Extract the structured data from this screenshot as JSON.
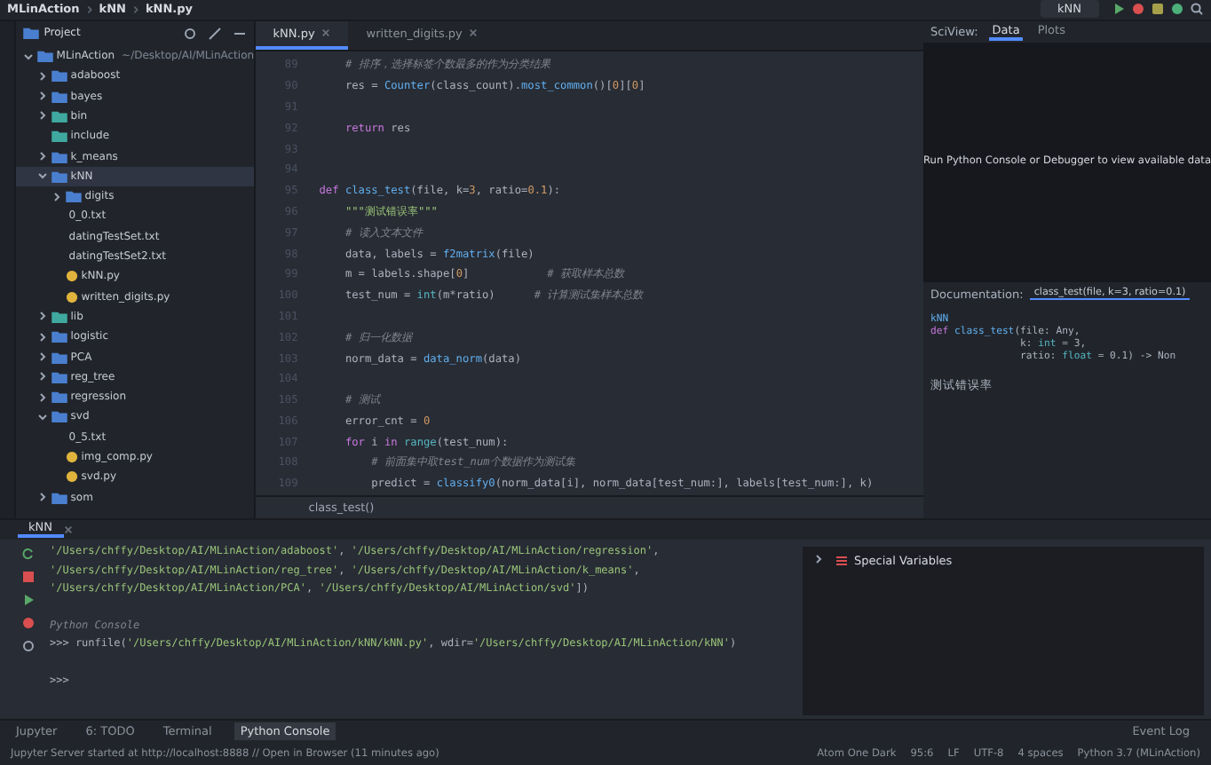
{
  "breadcrumb": [
    "MLinAction",
    "kNN",
    "kNN.py"
  ],
  "run_config": {
    "label": "kNN"
  },
  "project": {
    "title": "Project",
    "tree": [
      {
        "label": "MLinAction",
        "path": "~/Desktop/AI/MLinAction",
        "kind": "folder",
        "expanded": true,
        "selected": false,
        "children": [
          {
            "label": "adaboost",
            "kind": "folder",
            "expanded": false,
            "selected": false
          },
          {
            "label": "bayes",
            "kind": "folder",
            "expanded": false,
            "selected": false
          },
          {
            "label": "bin",
            "kind": "special_folder",
            "expanded": false,
            "selected": false
          },
          {
            "label": "include",
            "kind": "special_folder",
            "selected": false
          },
          {
            "label": "k_means",
            "kind": "folder",
            "expanded": false,
            "selected": false
          },
          {
            "label": "kNN",
            "kind": "folder",
            "expanded": true,
            "selected": true,
            "children": [
              {
                "label": "digits",
                "kind": "folder",
                "expanded": false,
                "selected": false
              },
              {
                "label": "0_0.txt",
                "kind": "text",
                "selected": false
              },
              {
                "label": "datingTestSet.txt",
                "kind": "text",
                "selected": false
              },
              {
                "label": "datingTestSet2.txt",
                "kind": "text",
                "selected": false
              },
              {
                "label": "kNN.py",
                "kind": "python",
                "selected": false
              },
              {
                "label": "written_digits.py",
                "kind": "python",
                "selected": false
              }
            ]
          },
          {
            "label": "lib",
            "kind": "special_folder",
            "expanded": false,
            "selected": false
          },
          {
            "label": "logistic",
            "kind": "folder",
            "expanded": false,
            "selected": false
          },
          {
            "label": "PCA",
            "kind": "folder",
            "expanded": false,
            "selected": false
          },
          {
            "label": "reg_tree",
            "kind": "folder",
            "expanded": false,
            "selected": false
          },
          {
            "label": "regression",
            "kind": "folder",
            "expanded": false,
            "selected": false
          },
          {
            "label": "svd",
            "kind": "folder",
            "expanded": true,
            "selected": false,
            "children": [
              {
                "label": "0_5.txt",
                "kind": "text",
                "selected": false
              },
              {
                "label": "img_comp.py",
                "kind": "python",
                "selected": false
              },
              {
                "label": "svd.py",
                "kind": "python",
                "selected": false
              }
            ]
          },
          {
            "label": "som",
            "kind": "folder",
            "expanded": false,
            "selected": false
          }
        ]
      }
    ]
  },
  "editor": {
    "tabs": [
      {
        "label": "kNN.py",
        "selected": true
      },
      {
        "label": "written_digits.py",
        "selected": false
      }
    ],
    "lines": [
      {
        "number": "89",
        "tokens": [
          {
            "kind": "comment",
            "text": "    # 排序，选择标签个数最多的作为分类结果"
          }
        ]
      },
      {
        "number": "90",
        "tokens": [
          {
            "kind": "plain",
            "text": "    res = "
          },
          {
            "kind": "func",
            "text": "Counter"
          },
          {
            "kind": "plain",
            "text": "(class_count)."
          },
          {
            "kind": "func",
            "text": "most_common"
          },
          {
            "kind": "plain",
            "text": "()["
          },
          {
            "kind": "number",
            "text": "0"
          },
          {
            "kind": "plain",
            "text": "]["
          },
          {
            "kind": "number",
            "text": "0"
          },
          {
            "kind": "plain",
            "text": "]"
          }
        ]
      },
      {
        "number": "91"
      },
      {
        "number": "92",
        "tokens": [
          {
            "kind": "keyword",
            "text": "    return"
          },
          {
            "kind": "plain",
            "text": " res"
          }
        ]
      },
      {
        "number": "93"
      },
      {
        "number": "94"
      },
      {
        "number": "95",
        "tokens": [
          {
            "kind": "keyword",
            "text": "def "
          },
          {
            "kind": "func",
            "text": "class_test"
          },
          {
            "kind": "plain",
            "text": "(file, k="
          },
          {
            "kind": "number",
            "text": "3"
          },
          {
            "kind": "plain",
            "text": ", ratio="
          },
          {
            "kind": "number",
            "text": "0.1"
          },
          {
            "kind": "plain",
            "text": "):"
          }
        ]
      },
      {
        "number": "96",
        "tokens": [
          {
            "kind": "doc",
            "text": "    \"\"\"测试错误率\"\"\""
          }
        ]
      },
      {
        "number": "97",
        "tokens": [
          {
            "kind": "comment",
            "text": "    # 读入文本文件"
          }
        ]
      },
      {
        "number": "98",
        "tokens": [
          {
            "kind": "plain",
            "text": "    data, labels = "
          },
          {
            "kind": "func",
            "text": "f2matrix"
          },
          {
            "kind": "plain",
            "text": "(file)"
          }
        ]
      },
      {
        "number": "99",
        "tokens": [
          {
            "kind": "plain",
            "text": "    m = labels.shape["
          },
          {
            "kind": "number",
            "text": "0"
          },
          {
            "kind": "plain",
            "text": "]"
          },
          {
            "kind": "comment",
            "text": "            # 获取样本总数"
          }
        ]
      },
      {
        "number": "100",
        "tokens": [
          {
            "kind": "plain",
            "text": "    test_num = "
          },
          {
            "kind": "builtin",
            "text": "int"
          },
          {
            "kind": "plain",
            "text": "(m*ratio)"
          },
          {
            "kind": "comment",
            "text": "      # 计算测试集样本总数"
          }
        ]
      },
      {
        "number": "101"
      },
      {
        "number": "102",
        "tokens": [
          {
            "kind": "comment",
            "text": "    # 归一化数据"
          }
        ]
      },
      {
        "number": "103",
        "tokens": [
          {
            "kind": "plain",
            "text": "    norm_data = "
          },
          {
            "kind": "func",
            "text": "data_norm"
          },
          {
            "kind": "plain",
            "text": "(data)"
          }
        ]
      },
      {
        "number": "104"
      },
      {
        "number": "105",
        "tokens": [
          {
            "kind": "comment",
            "text": "    # 测试"
          }
        ]
      },
      {
        "number": "106",
        "tokens": [
          {
            "kind": "plain",
            "text": "    error_cnt = "
          },
          {
            "kind": "number",
            "text": "0"
          }
        ]
      },
      {
        "number": "107",
        "tokens": [
          {
            "kind": "keyword",
            "text": "    for"
          },
          {
            "kind": "plain",
            "text": " i "
          },
          {
            "kind": "keyword",
            "text": "in "
          },
          {
            "kind": "builtin",
            "text": "range"
          },
          {
            "kind": "plain",
            "text": "(test_num):"
          }
        ]
      },
      {
        "number": "108",
        "tokens": [
          {
            "kind": "comment",
            "text": "        # 前面集中取test_num个数据作为测试集"
          }
        ]
      },
      {
        "number": "109",
        "tokens": [
          {
            "kind": "plain",
            "text": "        predict = "
          },
          {
            "kind": "func",
            "text": "classify0"
          },
          {
            "kind": "plain",
            "text": "(norm_data[i], norm_data[test_num:], labels[test_num:], k)"
          }
        ]
      }
    ],
    "footer": "class_test()"
  },
  "sciview": {
    "label": "SciView:",
    "tabs": [
      {
        "label": "Data",
        "selected": true
      },
      {
        "label": "Plots",
        "selected": false
      }
    ],
    "message": "Run Python Console or Debugger to view available data"
  },
  "documentation": {
    "label": "Documentation:",
    "tab": "class_test(file, k=3, ratio=0.1)",
    "module": "kNN",
    "signature": [
      [
        {
          "kind": "keyword",
          "text": "def "
        },
        {
          "kind": "func",
          "text": "class_test"
        },
        {
          "kind": "plain",
          "text": "(file: Any,"
        }
      ],
      [
        {
          "kind": "plain",
          "text": "               k: "
        },
        {
          "kind": "builtin",
          "text": "int"
        },
        {
          "kind": "plain",
          "text": " = 3,"
        }
      ],
      [
        {
          "kind": "plain",
          "text": "               ratio: "
        },
        {
          "kind": "builtin",
          "text": "float"
        },
        {
          "kind": "plain",
          "text": " = 0.1) -> Non"
        }
      ]
    ],
    "description": "测试错误率"
  },
  "console": {
    "tab": "kNN",
    "lines": [
      {
        "kind": "output",
        "tokens": [
          {
            "kind": "string",
            "text": "'/Users/chffy/Desktop/AI/MLinAction/adaboost'"
          },
          {
            "kind": "plain",
            "text": ", "
          },
          {
            "kind": "string",
            "text": "'/Users/chffy/Desktop/AI/MLinAction/regression'"
          },
          {
            "kind": "plain",
            "text": ","
          }
        ]
      },
      {
        "kind": "output",
        "tokens": [
          {
            "kind": "string",
            "text": "'/Users/chffy/Desktop/AI/MLinAction/reg_tree'"
          },
          {
            "kind": "plain",
            "text": ", "
          },
          {
            "kind": "string",
            "text": "'/Users/chffy/Desktop/AI/MLinAction/k_means'"
          },
          {
            "kind": "plain",
            "text": ","
          }
        ]
      },
      {
        "kind": "output",
        "tokens": [
          {
            "kind": "string",
            "text": "'/Users/chffy/Desktop/AI/MLinAction/PCA'"
          },
          {
            "kind": "plain",
            "text": ", "
          },
          {
            "kind": "string",
            "text": "'/Users/chffy/Desktop/AI/MLinAction/svd'"
          },
          {
            "kind": "plain",
            "text": "])"
          }
        ]
      },
      {
        "kind": "section",
        "tokens": [
          {
            "kind": "comment",
            "text": "Python Console"
          }
        ]
      },
      {
        "kind": "input",
        "tokens": [
          {
            "kind": "plain",
            "text": ">>> runfile("
          },
          {
            "kind": "string",
            "text": "'/Users/chffy/Desktop/AI/MLinAction/kNN/kNN.py'"
          },
          {
            "kind": "plain",
            "text": ", wdir="
          },
          {
            "kind": "string",
            "text": "'/Users/chffy/Desktop/AI/MLinAction/kNN'"
          },
          {
            "kind": "plain",
            "text": ")"
          }
        ]
      },
      {
        "kind": "prompt",
        "tokens": [
          {
            "kind": "plain",
            "text": ">>>"
          }
        ]
      }
    ],
    "variables": "Special Variables"
  },
  "tool_tabs": [
    {
      "label": "Jupyter",
      "selected": false
    },
    {
      "label": "6: TODO",
      "selected": false
    },
    {
      "label": "Terminal",
      "selected": false
    },
    {
      "label": "Python Console",
      "selected": true
    }
  ],
  "event_log": "Event Log",
  "status": {
    "message": "Jupyter Server started at http://localhost:8888 // Open in Browser (11 minutes ago)",
    "items": [
      "Atom One Dark",
      "95:6",
      "LF",
      "UTF-8",
      "4 spaces",
      "Python 3.7 (MLinAction)"
    ]
  }
}
